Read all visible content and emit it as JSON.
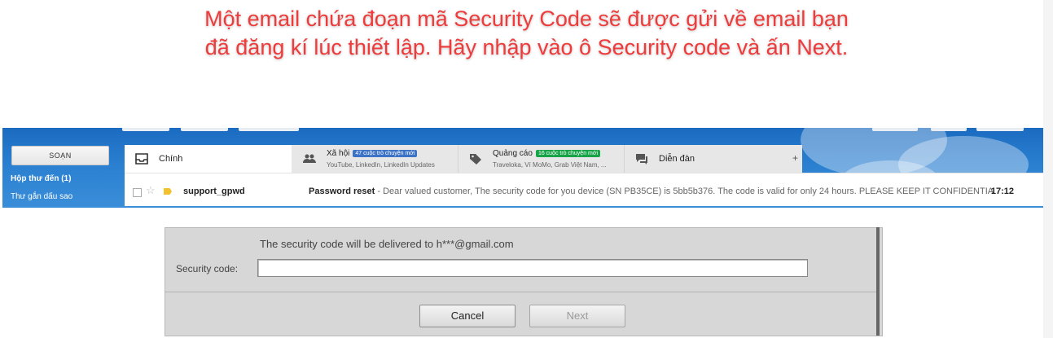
{
  "instruction": {
    "line1": "Một email chứa đoạn mã Security Code sẽ được gửi về email bạn",
    "line2": "đã đăng kí lúc thiết lập. Hãy nhập  vào ô Security code và ấn Next.",
    "color": "#ee3b3b"
  },
  "gmail": {
    "compose_label": "SOẠN",
    "sidebar": [
      {
        "label": "Hộp thư đến (1)",
        "bold": true
      },
      {
        "label": "Thư gắn dấu sao",
        "bold": false
      }
    ],
    "tabs": [
      {
        "label": "Chính",
        "icon": "inbox-icon"
      },
      {
        "label": "Xã hội",
        "icon": "people-icon",
        "badge": "47 cuộc trò chuyện mới",
        "badge_color": "#3d73c6",
        "sub": "YouTube, LinkedIn, LinkedIn Updates"
      },
      {
        "label": "Quảng cáo",
        "icon": "tag-icon",
        "badge": "16 cuộc trò chuyện mới",
        "badge_color": "#17a348",
        "sub": "Traveloka, Ví MoMo, Grab Việt Nam, ..."
      },
      {
        "label": "Diễn đàn",
        "icon": "forum-icon"
      }
    ],
    "add_tab": "+",
    "email": {
      "sender": "support_gpwd",
      "subject": "Password reset",
      "snippet": " - Dear valued customer, The security code for you device (SN PB35CE) is 5bb5b376. The code is valid for only 24 hours. PLEASE KEEP IT CONFIDENTIA",
      "time": "17:12"
    }
  },
  "dialog": {
    "notice": "The security code will be delivered to h***@gmail.com",
    "field_label": "Security code:",
    "field_value": "",
    "cancel_label": "Cancel",
    "next_label": "Next"
  }
}
